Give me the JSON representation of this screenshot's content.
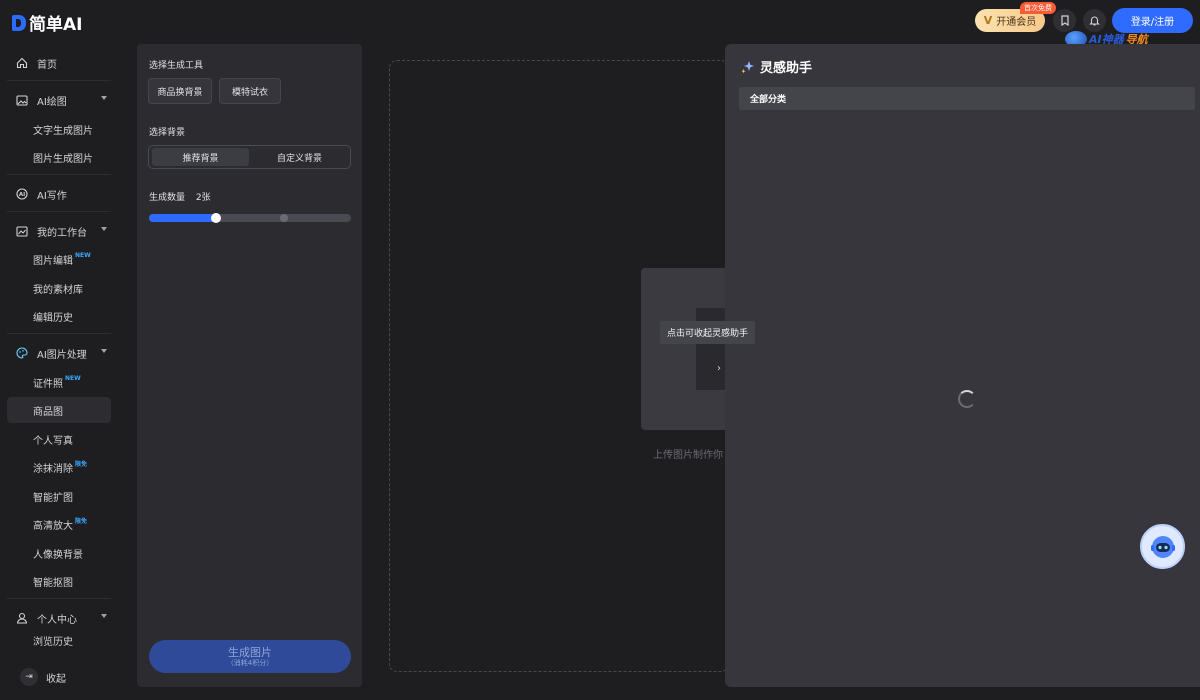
{
  "header": {
    "logo_text": "简单AI",
    "vip_label": "开通会员",
    "vip_badge": "首次免费",
    "login_label": "登录/注册",
    "watermark_text": "AI神器",
    "watermark_text2": "导航"
  },
  "sidebar": {
    "home": "首页",
    "ai_draw": {
      "label": "AI绘图",
      "items": [
        "文字生成图片",
        "图片生成图片"
      ]
    },
    "ai_write": "AI写作",
    "workspace": {
      "label": "我的工作台",
      "items": [
        "图片编辑",
        "我的素材库",
        "编辑历史"
      ],
      "new_badge": "NEW"
    },
    "ai_image": {
      "label": "AI图片处理",
      "items": [
        "证件照",
        "商品图",
        "个人写真",
        "涂抹消除",
        "智能扩图",
        "高清放大",
        "人像换背景",
        "智能抠图"
      ],
      "new_badge": "NEW",
      "hot_badge": "限免"
    },
    "personal": {
      "label": "个人中心",
      "items": [
        "浏览历史"
      ]
    },
    "collapse": "收起"
  },
  "tool_panel": {
    "tool_title": "选择生成工具",
    "tools": [
      "商品换背景",
      "模特试衣"
    ],
    "bg_title": "选择背景",
    "bg_options": [
      "推荐背景",
      "自定义背景"
    ],
    "count_label": "生成数量",
    "count_value": "2张",
    "count_progress": 0.33,
    "generate_label": "生成图片",
    "generate_sub": "（消耗4积分）"
  },
  "canvas": {
    "upload_hint": "上传图片制作你",
    "tooltip": "点击可收起灵感助手"
  },
  "inspiration": {
    "title": "灵感助手",
    "category": "全部分类"
  },
  "colors": {
    "accent": "#2f6bff",
    "vip": "#f6c98a",
    "badge": "#ff5a36"
  }
}
